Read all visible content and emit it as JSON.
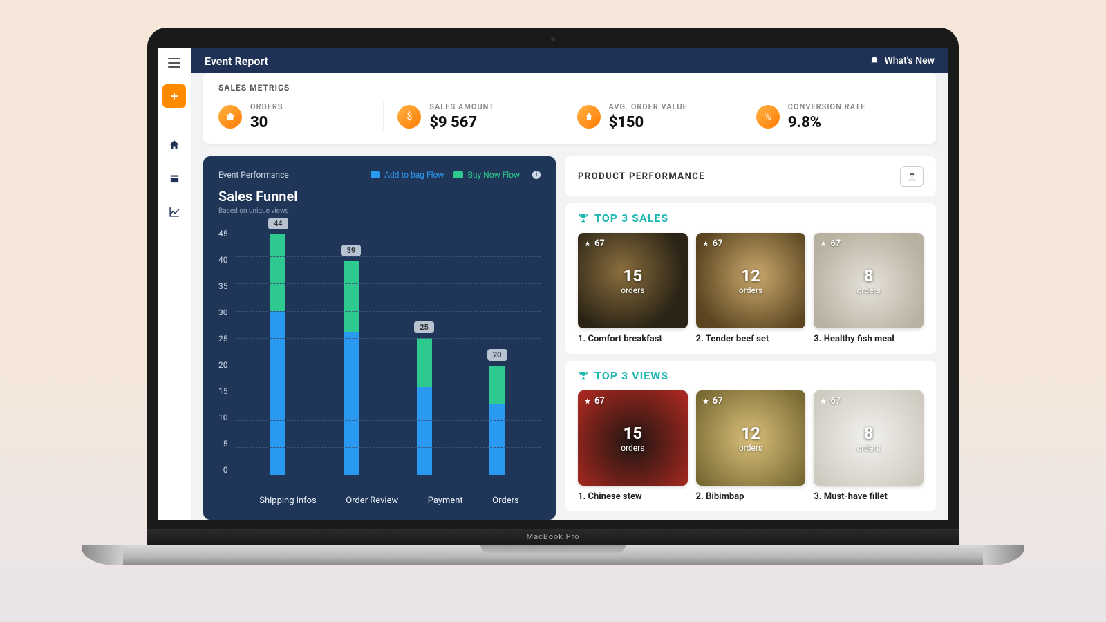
{
  "header": {
    "title": "Event Report",
    "whats_new": "What's New"
  },
  "metrics": {
    "title": "SALES METRICS",
    "items": [
      {
        "label": "ORDERS",
        "value": "30"
      },
      {
        "label": "SALES AMOUNT",
        "value": "$9 567"
      },
      {
        "label": "AVG. ORDER VALUE",
        "value": "$150"
      },
      {
        "label": "CONVERSION RATE",
        "value": "9.8%"
      }
    ]
  },
  "chart": {
    "panel_label": "Event Performance",
    "legend": {
      "blue": "Add to bag Flow",
      "green": "Buy Now Flow"
    },
    "title": "Sales Funnel",
    "subtitle": "Based on unique views"
  },
  "chart_data": {
    "type": "bar",
    "stacked": true,
    "categories": [
      "Shipping infos",
      "Order Review",
      "Payment",
      "Orders"
    ],
    "series": [
      {
        "name": "Add to bag Flow",
        "color": "#2a99f0",
        "values": [
          30,
          26,
          16,
          13
        ]
      },
      {
        "name": "Buy Now Flow",
        "color": "#2ec98f",
        "values": [
          14,
          13,
          9,
          7
        ]
      }
    ],
    "totals": [
      44,
      39,
      25,
      20
    ],
    "ylim": [
      0,
      45
    ],
    "yticks": [
      45,
      40,
      35,
      30,
      25,
      20,
      15,
      10,
      5,
      0
    ],
    "xlabel": "",
    "ylabel": ""
  },
  "product": {
    "title": "PRODUCT PERFORMANCE",
    "sections": [
      {
        "title": "TOP 3 SALES",
        "cards": [
          {
            "badge": "67",
            "big": "15",
            "small": "orders",
            "name": "1. Comfort breakfast"
          },
          {
            "badge": "67",
            "big": "12",
            "small": "orders",
            "name": "2. Tender beef set"
          },
          {
            "badge": "67",
            "big": "8",
            "small": "orders",
            "name": "3. Healthy fish meal"
          }
        ]
      },
      {
        "title": "TOP 3 VIEWS",
        "cards": [
          {
            "badge": "67",
            "big": "15",
            "small": "orders",
            "name": "1. Chinese stew"
          },
          {
            "badge": "67",
            "big": "12",
            "small": "orders",
            "name": "2. Bibimbap"
          },
          {
            "badge": "67",
            "big": "8",
            "small": "orders",
            "name": "3. Must-have fillet"
          }
        ]
      }
    ]
  },
  "device": "MacBook Pro"
}
